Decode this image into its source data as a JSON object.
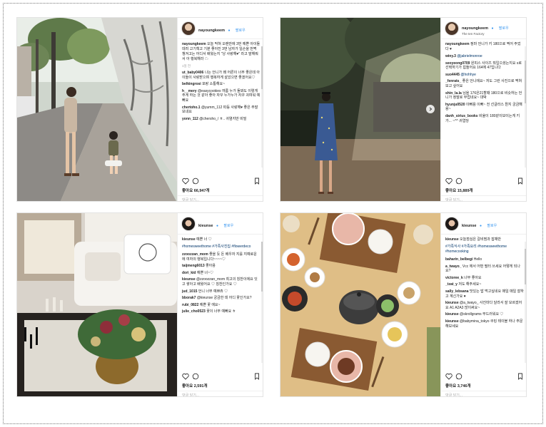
{
  "posts": [
    {
      "username": "nayoungkeem",
      "follow": "팔로우",
      "location": "",
      "caption": "오늘 막혀 오랜만에 3번 예쁜 아이들 데려 고기책고 기분 좋아진 3번 남자가 일손을 번쩍 챙겨고는 어디서 배웠는지 \"낭 사랑해♥\" 라고 말해줘서 아 행복해라 ☁",
      "time": "1일 전",
      "comments": [
        {
          "user": "ut_baby0406",
          "text": "나는 언니가 왜 어른이 너무 좋은데 아이들이 사랑받으며 행복하게 살았으면 좋겠어요♡"
        },
        {
          "user": "belkingrosi",
          "text": "포랑 소통해요~"
        },
        {
          "user": "h__mery",
          "text": "@easycookies 여름 누가 돌봐도 이렇게 주게 하는 것 같아 좋아 자꾸 누가누가 자꾸 귀여워 예뻐요"
        },
        {
          "user": "chertoho.1",
          "text": "@yumm_112 따등 사랑해♥ 좋은 주말 보내요"
        },
        {
          "user": "yonn_112",
          "text": "@chersho_/ ㅎ.. 귀염지만 비밀"
        }
      ],
      "likes": "좋아요 66,947개",
      "add_comment": "댓글 달기..."
    },
    {
      "username": "nayoungkeem",
      "follow": "팔로우",
      "location": "The ten Factory",
      "caption": "정마 언니가 키 180으로 찍어 주었다 ♥",
      "time": "",
      "comments": [
        {
          "user": "winy.3",
          "text": "@jabrielmonroe"
        },
        {
          "user": "seoyeong0709",
          "text": "원피스 사이즈 뭐입으셨는지요 s로 선택하기가 힘들어요 164에 47입니다"
        },
        {
          "user": "suo4445",
          "text": "@hohhye"
        },
        {
          "user": "_fenrats_",
          "text": "좋은 언니에요~ 저도 그런 사진으로 찍혀보고 싶어요"
        },
        {
          "user": "shin_la.la",
          "text": "님을 176은21할때 180으로 비슷하는 언니가 정말로 부럽네요~ 대박"
        },
        {
          "user": "hyunju0520",
          "text": "이뻐용 이뻐~ 전 선글라스 뭔지 궁금해용~"
        },
        {
          "user": "danh_sirius_books",
          "text": "비율이 180같이보이는게 키가... ~^^ 귀엽당"
        }
      ],
      "likes": "좋아요 15,889개",
      "add_comment": "댓글 달기..."
    },
    {
      "username": "kieunse",
      "follow": "팔로우",
      "location": "",
      "caption": "예쁜 너 ♡",
      "tags": "#homesweethome #가족사진집 #flowerdeco",
      "time": "",
      "comments": [
        {
          "user": "zzoozzan_mom",
          "text": "좋을 듯 돈 배우자 지를 지예로운 에 여자의 행복입니다~~~~♡"
        },
        {
          "user": "taijmeng6013",
          "text": "좋아용"
        },
        {
          "user": "dori_kid",
          "text": "예쁜 너~♡"
        },
        {
          "user": "kieunse",
          "text": "@zzoozzan_mom 최고의 칭찬이에요 잇고 쌓아고 배웠어요 ♡ 칭찬인가요 ♡"
        },
        {
          "user": "jud_1015",
          "text": "언니 너무 예쁘쥬 ♡"
        },
        {
          "user": "bborak7",
          "text": "@kieunse 궁금한 데 어디 꽃인가요?"
        },
        {
          "user": "rubi_0822",
          "text": "예쁜 꽃 에요~"
        },
        {
          "user": "julie_cho0523",
          "text": "꽃이 너무 예뻐요 ㅎ"
        }
      ],
      "likes": "좋아요 2,591개",
      "add_comment": "댓글 달기..."
    },
    {
      "username": "kieunse",
      "follow": "팔로우",
      "location": "",
      "caption": "오늘점심은 갈비찜과 잡채만",
      "tags": "#가족식사 #가족요리 #homesweethome #homecooking",
      "time": "",
      "comments": [
        {
          "user": "baharin_belbegi",
          "text": "Hello"
        },
        {
          "user": "a_twayo_",
          "text": "Vcc 에서 어떤 필터 쓰세요 어떻게 되나요?"
        },
        {
          "user": "victoree_k",
          "text": "너무 좋아요"
        },
        {
          "user": "_tzat_y",
          "text": "저도 해주세요~"
        },
        {
          "user": "sally_lebsana",
          "text": "맛있는 밥 먹고싶네요 매일 매일 잘하고 계신가요 ♥"
        },
        {
          "user": "kieunse",
          "text": "@a_twayo_ 사진마다 달라서 잘 모르겠어요 A1 A2A3 많이써요~"
        },
        {
          "user": "kieunse",
          "text": "@skrollgrams 부드러워요 ♡"
        },
        {
          "user": "kieunse",
          "text": "@babymina_tokyo 쿠킹 테이블 하나 주문해보세요"
        }
      ],
      "likes": "좋아요 3,746개",
      "add_comment": "댓글 달기..."
    }
  ]
}
